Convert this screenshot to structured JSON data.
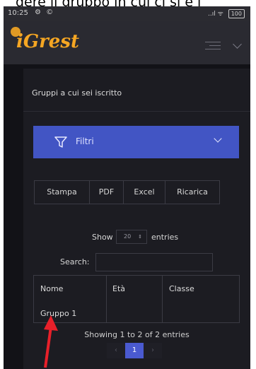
{
  "caption": "dere il gruppo in cui ci si è i",
  "status": {
    "time": "10:25",
    "icons": "⚙ ©",
    "signal": "..ıl ᯤ",
    "battery": "100"
  },
  "app": {
    "logo": "iGrest"
  },
  "card": {
    "title": "Gruppi a cui sei iscritto"
  },
  "filter": {
    "label": "Filtri"
  },
  "toolbar": {
    "buttons": [
      "Stampa",
      "PDF",
      "Excel",
      "Ricarica"
    ]
  },
  "length": {
    "prefix": "Show",
    "value": "20",
    "arrow": "⇕",
    "suffix": "entries"
  },
  "search": {
    "label": "Search:",
    "value": ""
  },
  "table": {
    "headers": [
      "Nome",
      "Età",
      "Classe"
    ],
    "rows": [
      [
        "Gruppo 1",
        "",
        ""
      ]
    ]
  },
  "info": "Showing 1 to 2 of 2 entries",
  "pagination": {
    "prev": "‹",
    "current": "1",
    "next": "›"
  },
  "colors": {
    "background": "#121217",
    "card": "#1c1c22",
    "filter": "#4255c4",
    "logo": "#f5a623",
    "annotation_arrow": "#e8202a"
  }
}
